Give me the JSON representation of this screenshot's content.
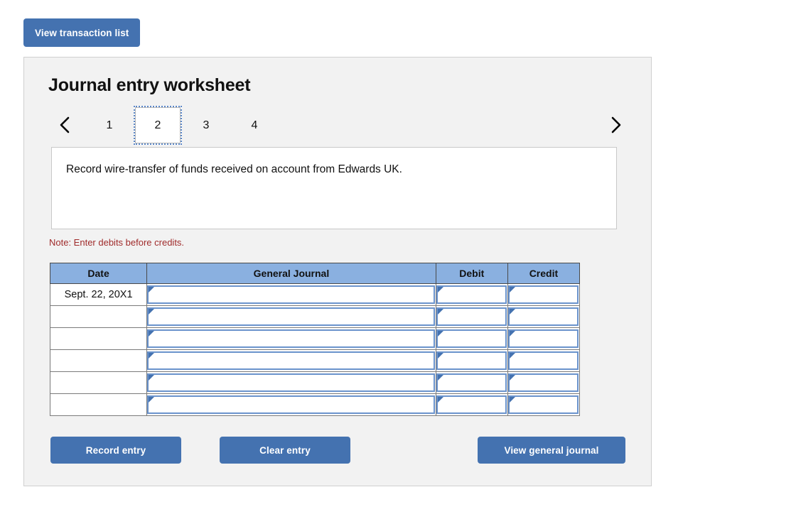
{
  "top_bar": {
    "view_transaction_list_label": "View transaction list"
  },
  "worksheet": {
    "title": "Journal entry worksheet",
    "nav": {
      "prev_icon": "chevron-left-icon",
      "next_icon": "chevron-right-icon"
    },
    "tabs": [
      {
        "label": "1",
        "selected": false
      },
      {
        "label": "2",
        "selected": true
      },
      {
        "label": "3",
        "selected": false
      },
      {
        "label": "4",
        "selected": false
      }
    ],
    "description": "Record wire-transfer of funds received on account from Edwards UK.",
    "note": "Note: Enter debits before credits.",
    "table": {
      "headers": [
        "Date",
        "General Journal",
        "Debit",
        "Credit"
      ],
      "rows": [
        {
          "date": "Sept. 22, 20X1",
          "journal": "",
          "debit": "",
          "credit": ""
        },
        {
          "date": "",
          "journal": "",
          "debit": "",
          "credit": ""
        },
        {
          "date": "",
          "journal": "",
          "debit": "",
          "credit": ""
        },
        {
          "date": "",
          "journal": "",
          "debit": "",
          "credit": ""
        },
        {
          "date": "",
          "journal": "",
          "debit": "",
          "credit": ""
        },
        {
          "date": "",
          "journal": "",
          "debit": "",
          "credit": ""
        }
      ]
    },
    "actions": {
      "record_entry_label": "Record entry",
      "clear_entry_label": "Clear entry",
      "view_general_journal_label": "View general journal"
    }
  },
  "colors": {
    "button_blue": "#4472b0",
    "table_header_blue": "#8ab0e0",
    "note_red": "#a02c2c",
    "panel_bg": "#f2f2f2",
    "input_border_blue": "#6a93cc"
  }
}
